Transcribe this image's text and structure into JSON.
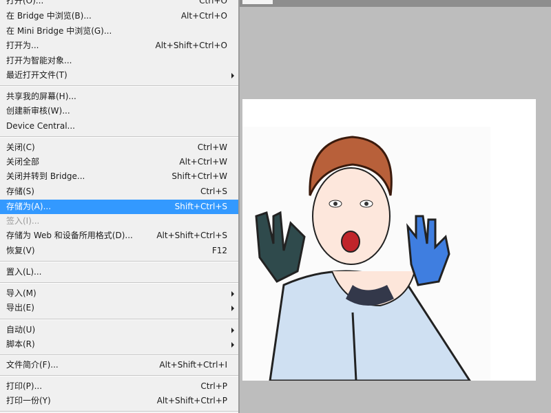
{
  "menu": {
    "highlight_color": "#3399ff",
    "items": [
      {
        "label": "打开(O)...",
        "shortcut": "Ctrl+O"
      },
      {
        "label": "在 Bridge 中浏览(B)...",
        "shortcut": "Alt+Ctrl+O"
      },
      {
        "label": "在 Mini Bridge 中浏览(G)...",
        "shortcut": ""
      },
      {
        "label": "打开为...",
        "shortcut": "Alt+Shift+Ctrl+O"
      },
      {
        "label": "打开为智能对象...",
        "shortcut": ""
      },
      {
        "label": "最近打开文件(T)",
        "shortcut": "",
        "submenu": true
      },
      {
        "label": "共享我的屏幕(H)...",
        "shortcut": ""
      },
      {
        "label": "创建新审核(W)...",
        "shortcut": ""
      },
      {
        "label": "Device Central...",
        "shortcut": ""
      },
      {
        "label": "关闭(C)",
        "shortcut": "Ctrl+W"
      },
      {
        "label": "关闭全部",
        "shortcut": "Alt+Ctrl+W"
      },
      {
        "label": "关闭并转到 Bridge...",
        "shortcut": "Shift+Ctrl+W"
      },
      {
        "label": "存储(S)",
        "shortcut": "Ctrl+S"
      },
      {
        "label": "存储为(A)...",
        "shortcut": "Shift+Ctrl+S",
        "highlighted": true
      },
      {
        "label": "签入(I)...",
        "shortcut": "",
        "disabled": true
      },
      {
        "label": "存储为 Web 和设备所用格式(D)...",
        "shortcut": "Alt+Shift+Ctrl+S"
      },
      {
        "label": "恢复(V)",
        "shortcut": "F12"
      },
      {
        "label": "置入(L)...",
        "shortcut": ""
      },
      {
        "label": "导入(M)",
        "shortcut": "",
        "submenu": true
      },
      {
        "label": "导出(E)",
        "shortcut": "",
        "submenu": true
      },
      {
        "label": "自动(U)",
        "shortcut": "",
        "submenu": true
      },
      {
        "label": "脚本(R)",
        "shortcut": "",
        "submenu": true
      },
      {
        "label": "文件简介(F)...",
        "shortcut": "Alt+Shift+Ctrl+I"
      },
      {
        "label": "打印(P)...",
        "shortcut": "Ctrl+P"
      },
      {
        "label": "打印一份(Y)",
        "shortcut": "Alt+Shift+Ctrl+P"
      }
    ]
  }
}
